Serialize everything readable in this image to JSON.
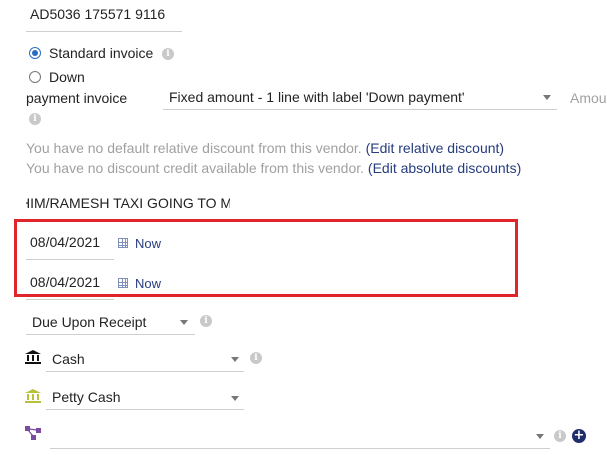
{
  "ref_field": {
    "value": "AD5036 175571 9116"
  },
  "invoice_type": {
    "standard_label": "Standard invoice",
    "down_label_line1": "Down",
    "down_label_line2": "payment invoice",
    "down_payment_option": "Fixed amount - 1 line with label 'Down payment'",
    "amount_label": "Amou"
  },
  "discounts": {
    "relative_text": "You have no default relative discount from this vendor.",
    "relative_link": "(Edit relative discount)",
    "absolute_text": "You have no discount credit available from this vendor.",
    "absolute_link": "(Edit absolute discounts)"
  },
  "label_field": {
    "value": "HIM/RAMESH TAXI GOING TO M"
  },
  "dates": {
    "date1": "08/04/2021",
    "date2": "08/04/2021",
    "now_label": "Now",
    "highlight_color": "#e0262b"
  },
  "payment_terms": {
    "value": "Due Upon Receipt"
  },
  "payment_mode": {
    "value": "Cash",
    "icon": "bank-icon"
  },
  "bank_account": {
    "value": "Petty Cash",
    "icon": "bank-account-icon",
    "icon_color": "#b7c23a"
  },
  "project": {
    "value": "",
    "icon": "project-icon",
    "icon_color": "#7c4a9e"
  }
}
